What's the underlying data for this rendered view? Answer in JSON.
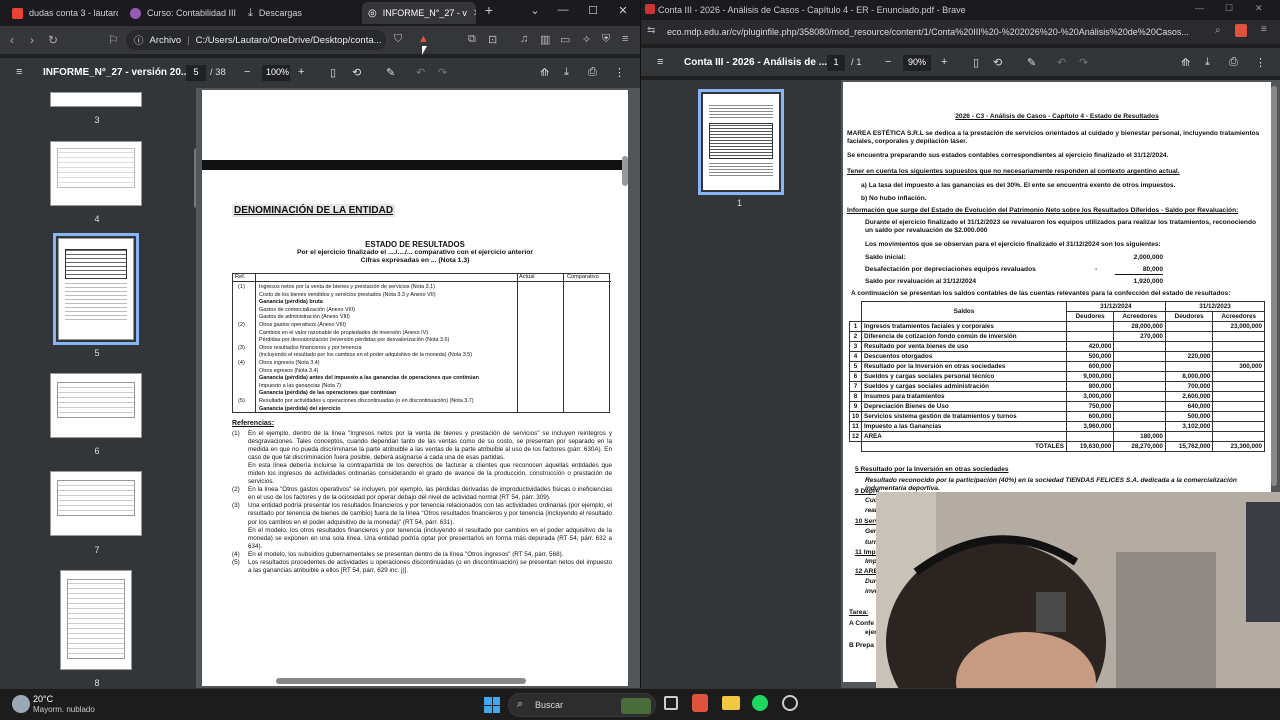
{
  "left_browser": {
    "tabs": [
      {
        "label": "dudas conta 3 - lautaro",
        "icon_color": "#ea4335"
      },
      {
        "label": "Curso: Contabilidad III |",
        "icon_color": "#9b59b6"
      },
      {
        "label": "Descargas",
        "icon_color": "#bbbbbb"
      },
      {
        "label": "INFORME_N°_27 - v",
        "icon_color": "#bbbbbb"
      }
    ],
    "address": {
      "file_label": "Archivo",
      "path": "C:/Users/Lautaro/OneDrive/Desktop/conta..."
    },
    "pdf": {
      "title": "INFORME_N°_27 - versión 20...",
      "page_current": "5",
      "page_total": "/ 38",
      "zoom": "100%",
      "thumb_numbers": [
        "3",
        "4",
        "5",
        "6",
        "7",
        "8"
      ],
      "doc": {
        "entity": "DENOMINACIÓN DE LA ENTIDAD",
        "heading": "ESTADO DE RESULTADOS",
        "subheading": "Por el ejercicio finalizado el ..../..../... comparativo con el ejercicio anterior",
        "subheading2": "Cifras expresadas en ... (Nota 1.3)",
        "table_head": [
          "Ref.",
          "",
          "Actual",
          "Comparativo"
        ],
        "rows": [
          {
            "ref": "(1)",
            "text": "Ingresos netos por la venta de bienes y prestación de servicios (Nota 3.1)",
            "bold": false
          },
          {
            "ref": "",
            "text": "Costo de los bienes vendidos y servicios prestados (Nota 3.3 y Anexo VII)",
            "bold": false
          },
          {
            "ref": "",
            "text": "Ganancia (pérdida) bruta",
            "bold": true
          },
          {
            "ref": "",
            "text": "Gastos de comercialización (Anexo VIII)",
            "bold": false
          },
          {
            "ref": "",
            "text": "Gastos de administración (Anexo VIII)",
            "bold": false
          },
          {
            "ref": "(2)",
            "text": "Otros gastos operativos (Anexo VIII)",
            "bold": false
          },
          {
            "ref": "",
            "text": "Cambios en el valor razonable de propiedades de inversión (Anexo IV)",
            "bold": false
          },
          {
            "ref": "",
            "text": "Pérdidas por desvalorización (reversión pérdidas por desvalorización (Nota 3.6)",
            "bold": false
          },
          {
            "ref": "(3)",
            "text": "Otros resultados financieros y por tenencia",
            "bold": false
          },
          {
            "ref": "",
            "text": "(incluyendo el resultado por los cambios en el poder adquisitivo de la moneda) (Nota 3.5)",
            "bold": false
          },
          {
            "ref": "(4)",
            "text": "Otros ingresos (Nota 3.4)",
            "bold": false
          },
          {
            "ref": "",
            "text": "Otros egresos (Nota 3.4)",
            "bold": false
          },
          {
            "ref": "",
            "text": "Ganancia (pérdida) antes del impuesto a las ganancias de operaciones que continúan",
            "bold": true
          },
          {
            "ref": "",
            "text": "Impuesto a las ganancias (Nota 7)",
            "bold": false
          },
          {
            "ref": "",
            "text": "Ganancia (pérdida) de las operaciones que continúan",
            "bold": true
          },
          {
            "ref": "(5)",
            "text": "Resultado por actividades u operaciones discontinuadas (o en discontinuación) (Nota 3.7)",
            "bold": false
          },
          {
            "ref": "",
            "text": "Ganancia (pérdida) del ejercicio",
            "bold": true
          }
        ],
        "refs_title": "Referencias:",
        "refs": [
          {
            "n": "(1)",
            "text": "En el ejemplo, dentro de la línea \"Ingresos netos por la venta de bienes y prestación de servicios\" se incluyen reintegros y desgravaciones. Tales conceptos, cuando dependan tanto de las ventas como de su costo, se presentan por separado en la medida en que no pueda discriminarse la parte atribuible a las ventas de la parte atribuible al uso de los factores (párr. 630A). En caso de que tal discriminación fuera posible, deberá asignarse a cada una de esas partidas."
          },
          {
            "n": "",
            "text": "En esta línea debería incluirse la contrapartida de los derechos de facturar a clientes que reconocen aquellas entidades que miden los ingresos de actividades ordinarias considerando el grado de avance de la producción, construcción o prestación de servicios."
          },
          {
            "n": "(2)",
            "text": "En la línea \"Otros gastos operativos\" se incluyen, por ejemplo, las pérdidas derivadas de improductividades físicas o ineficiencias en el uso de los factores y de la ociosidad por operar debajo del nivel de actividad normal (RT 54, párr. 309)."
          },
          {
            "n": "(3)",
            "text": "Una entidad podría presentar los resultados financieros y por tenencia relacionados con las actividades ordinarias (por ejemplo, el resultado por tenencia de bienes de cambio) fuera de la línea \"Otros resultados financieros y por tenencia (incluyendo el resultado por los cambios en el poder adquisitivo de la moneda)\" (RT 54, párr. 631)."
          },
          {
            "n": "",
            "text": "En el modelo, los otros resultados financieros y por tenencia (incluyendo el resultado por cambios en el poder adquisitivo de la moneda) se exponen en una sola línea. Una entidad podría optar por presentarlos en forma más depurada (RT 54, párr. 632 a 634)."
          },
          {
            "n": "(4)",
            "text": "En el modelo, los subsidios gubernamentales se presentan dentro de la línea \"Otros ingresos\" (RT 54, párr. 568)."
          },
          {
            "n": "(5)",
            "text": "Los resultados procedentes de actividades u operaciones discontinuadas (o en discontinuación) se presentan netos del impuesto a las ganancias atribuible a ellos [RT 54, párr. 629 inc. j)]."
          }
        ]
      }
    }
  },
  "right_browser": {
    "title": "Conta III - 2026 - Análisis de Casos - Capítulo 4 - ER - Enunciado.pdf - Brave",
    "url": "eco.mdp.edu.ar/cv/pluginfile.php/358080/mod_resource/content/1/Conta%20III%20-%202026%20-%20Análisis%20de%20Casos...",
    "pdf": {
      "title": "Conta III - 2026 - Análisis de ...",
      "page_current": "1",
      "page_total": "/ 1",
      "zoom": "90%",
      "thumb_number": "1",
      "doc": {
        "header": "2026 - C3 - Análisis de Casos - Capítulo 4 - Estado de Resultados",
        "intro": "MAREA ESTÉTICA S.R.L se dedica a la prestación de servicios orientados al cuidado y bienestar personal, incluyendo tratamientos faciales, corporales y depilación láser.",
        "intro2": "Se encuentra preparando sus estados contables correspondientes al ejercicio finalizado el 31/12/2024.",
        "assume_title": "Tener en cuenta los siguientes supuestos que no necesariamente responden al contexto argentino actual.",
        "assume_a": "a) La tasa del impuesto a las ganancias es del 30%. El ente se encuentra exento de otros impuestos.",
        "assume_b": "b) No hubo inflación.",
        "info_title": "Información que surge del Estado de Evolución del Patrimonio Neto sobre los Resultados Diferidos - Saldo por Revaluación:",
        "info_text": "Durante el ejercicio finalizado el 31/12/2023 se revaluaron los equipos utilizados para realizar los tratamientos, reconociendo un saldo por revaluación de $2.000.000",
        "movs_title": "Los movimientos que se observan para el ejercicio finalizado el 31/12/2024 son los siguientes:",
        "movs": [
          {
            "label": "Saldo inicial:",
            "value": "2,000,000"
          },
          {
            "label": "Desafectación por depreciaciones equipos revaluados",
            "value": "80,000",
            "sign": "-"
          },
          {
            "label": "Saldo por revaluación al 31/12/2024",
            "value": "1,920,000"
          }
        ],
        "balances_title": "A continuación se presentan los saldos contables de las cuentas relevantes para la confección del estado de resultados:",
        "table": {
          "col_saldos": "Saldos",
          "periods": [
            "31/12/2024",
            "31/12/2023"
          ],
          "sub": [
            "Deudores",
            "Acreedores",
            "Deudores",
            "Acreedores"
          ],
          "rows": [
            [
              "1",
              "Ingresos tratamientos faciales y corporales",
              "",
              "28,000,000",
              "",
              "23,000,000"
            ],
            [
              "2",
              "Diferencia de cotización fondo común de inversión",
              "",
              "270,000",
              "",
              ""
            ],
            [
              "3",
              "Resultado por venta bienes de uso",
              "420,000",
              "",
              "",
              ""
            ],
            [
              "4",
              "Descuentos otorgados",
              "500,000",
              "",
              "220,000",
              ""
            ],
            [
              "5",
              "Resultado por la Inversión en otras sociedades",
              "600,000",
              "",
              "",
              "300,000"
            ],
            [
              "6",
              "Sueldos y cargas sociales personal técnico",
              "9,000,000",
              "",
              "8,000,000",
              ""
            ],
            [
              "7",
              "Sueldos y cargas sociales administración",
              "800,000",
              "",
              "700,000",
              ""
            ],
            [
              "8",
              "Insumos para tratamientos",
              "3,000,000",
              "",
              "2,600,000",
              ""
            ],
            [
              "9",
              "Depreciación Bienes de Uso",
              "750,000",
              "",
              "640,000",
              ""
            ],
            [
              "10",
              "Servicios sistema gestión de tratamientos y turnos",
              "600,000",
              "",
              "500,000",
              ""
            ],
            [
              "11",
              "Impuesto a las Ganancias",
              "3,960,000",
              "",
              "3,102,000",
              ""
            ],
            [
              "12",
              "AREA",
              "",
              "180,000",
              "",
              ""
            ]
          ],
          "totals_label": "TOTALES",
          "totals": [
            "19,630,000",
            "28,270,000",
            "15,762,000",
            "23,300,000"
          ]
        },
        "note5_title": "5 Resultado por la Inversión en otras sociedades",
        "note5_text": "Resultado reconocido por la participación (40%) en la sociedad TIENDAS FELICES S.A. dedicada a la comercialización indumentaria deportiva.",
        "partial_lines": [
          "9 Depre",
          "Cuot",
          "real",
          "10 Servi",
          "Gen",
          "turn",
          "11 Impu",
          "Imp",
          "12 AREA",
          "Duro",
          "inve"
        ],
        "task_title": "Tarea:",
        "task_a": "A Confe",
        "task_a2": "ejerci",
        "task_b": "B Prepa"
      }
    }
  },
  "taskbar": {
    "weather_temp": "20°C",
    "weather_desc": "Mayorm. nublado",
    "search_placeholder": "Buscar"
  }
}
